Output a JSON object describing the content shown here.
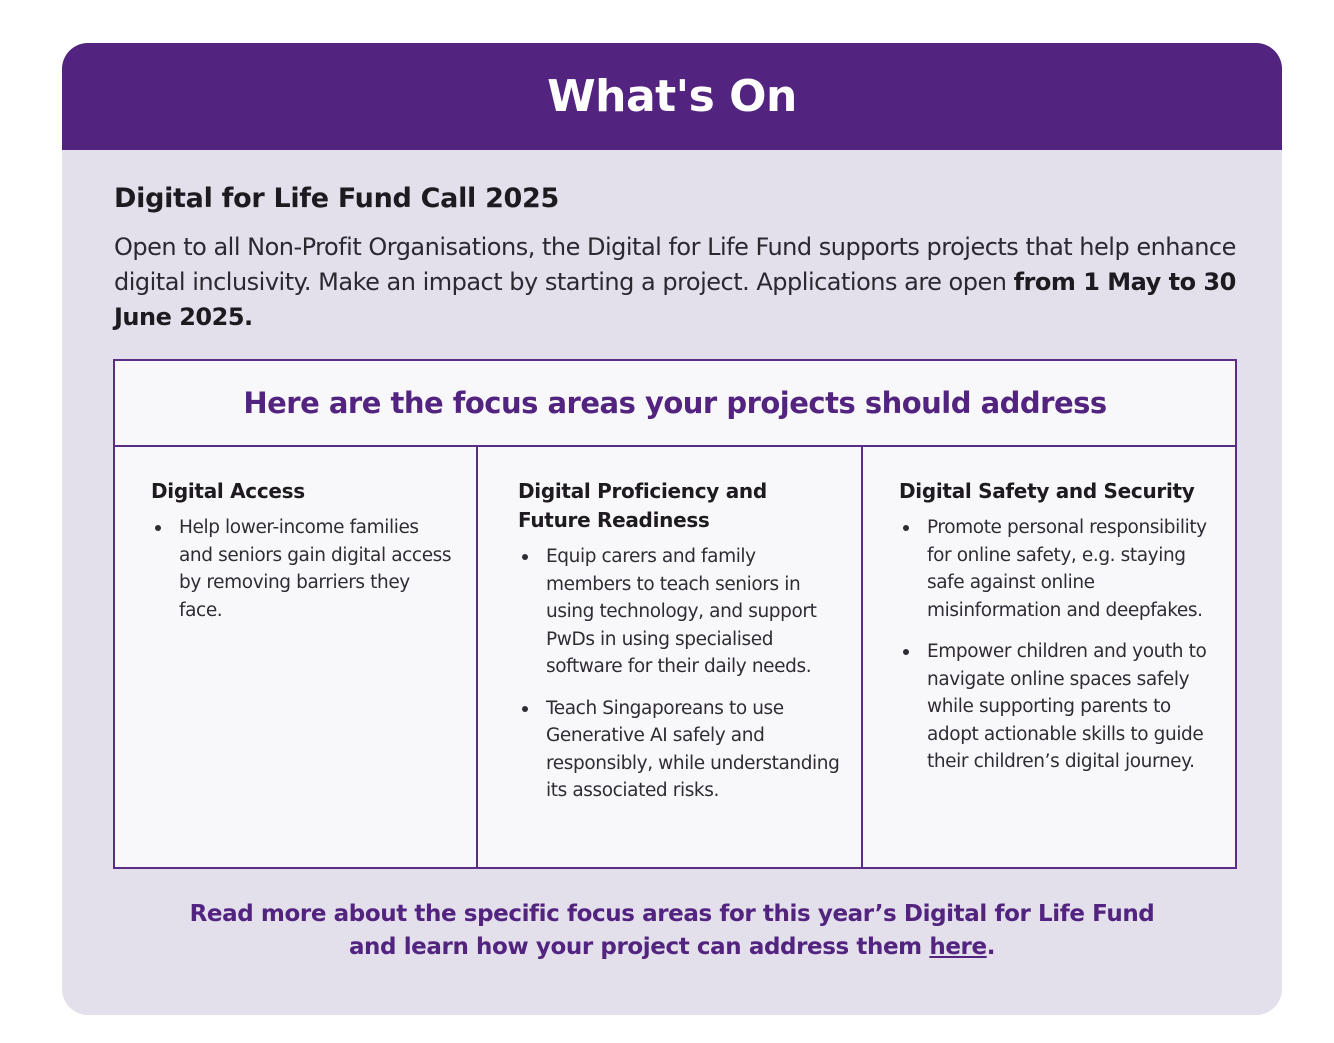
{
  "header": {
    "title": "What's On"
  },
  "fund": {
    "title": "Digital for Life Fund Call 2025",
    "description": "Open to all Non-Profit Organisations, the Digital for Life Fund supports projects that help enhance digital inclusivity. Make an impact by starting a project. Applications are open ",
    "date_range": "from 1 May to 30 June 2025."
  },
  "focus": {
    "title": "Here are the focus areas your projects should address",
    "areas": [
      {
        "heading": "Digital Access",
        "items": [
          "Help lower-income families and seniors gain digital access by removing barriers they face."
        ]
      },
      {
        "heading": "Digital Proficiency and Future Readiness",
        "items": [
          "Equip carers and family members to teach seniors in using technology, and support PwDs in using specialised software for their daily needs.",
          "Teach Singaporeans to use Generative AI safely and responsibly, while understanding its associated risks."
        ]
      },
      {
        "heading": "Digital Safety and Security",
        "items": [
          "Promote personal responsibility for online safety, e.g. staying safe against online misinformation and deepfakes.",
          "Empower children and youth to navigate online spaces safely while supporting parents to adopt actionable skills to guide their children’s digital journey."
        ]
      }
    ]
  },
  "readmore": {
    "line1": "Read more about the specific focus areas for this year’s Digital for Life Fund",
    "line2": "and learn how your project can address them ",
    "link_label": "here",
    "trailing": "."
  },
  "colors": {
    "brand_purple": "#52237f",
    "card_background": "#e3dfeb",
    "panel_background": "#f8f7fa"
  }
}
